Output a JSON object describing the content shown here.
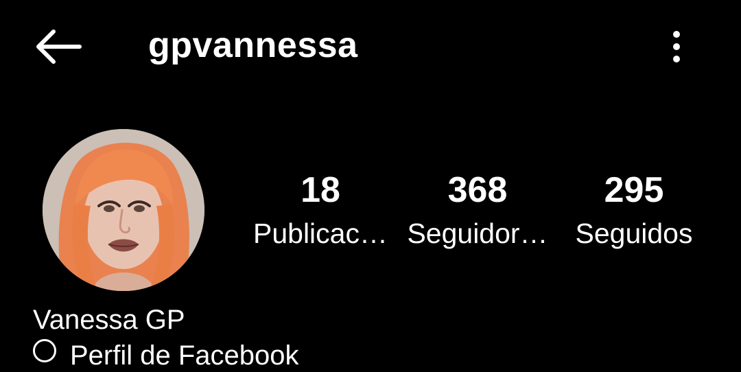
{
  "header": {
    "username": "gpvannessa",
    "back_icon": "arrow-left-icon",
    "more_icon": "more-vertical-icon"
  },
  "profile": {
    "avatar": "profile-photo",
    "display_name": "Vanessa GP",
    "next_line_text": "Perfil de Facebook"
  },
  "stats": [
    {
      "value": "18",
      "label": "Publicac…"
    },
    {
      "value": "368",
      "label": "Seguidor…"
    },
    {
      "value": "295",
      "label": "Seguidos"
    }
  ],
  "colors": {
    "background": "#000000",
    "text": "#ffffff",
    "hair": "#f08a5a"
  }
}
